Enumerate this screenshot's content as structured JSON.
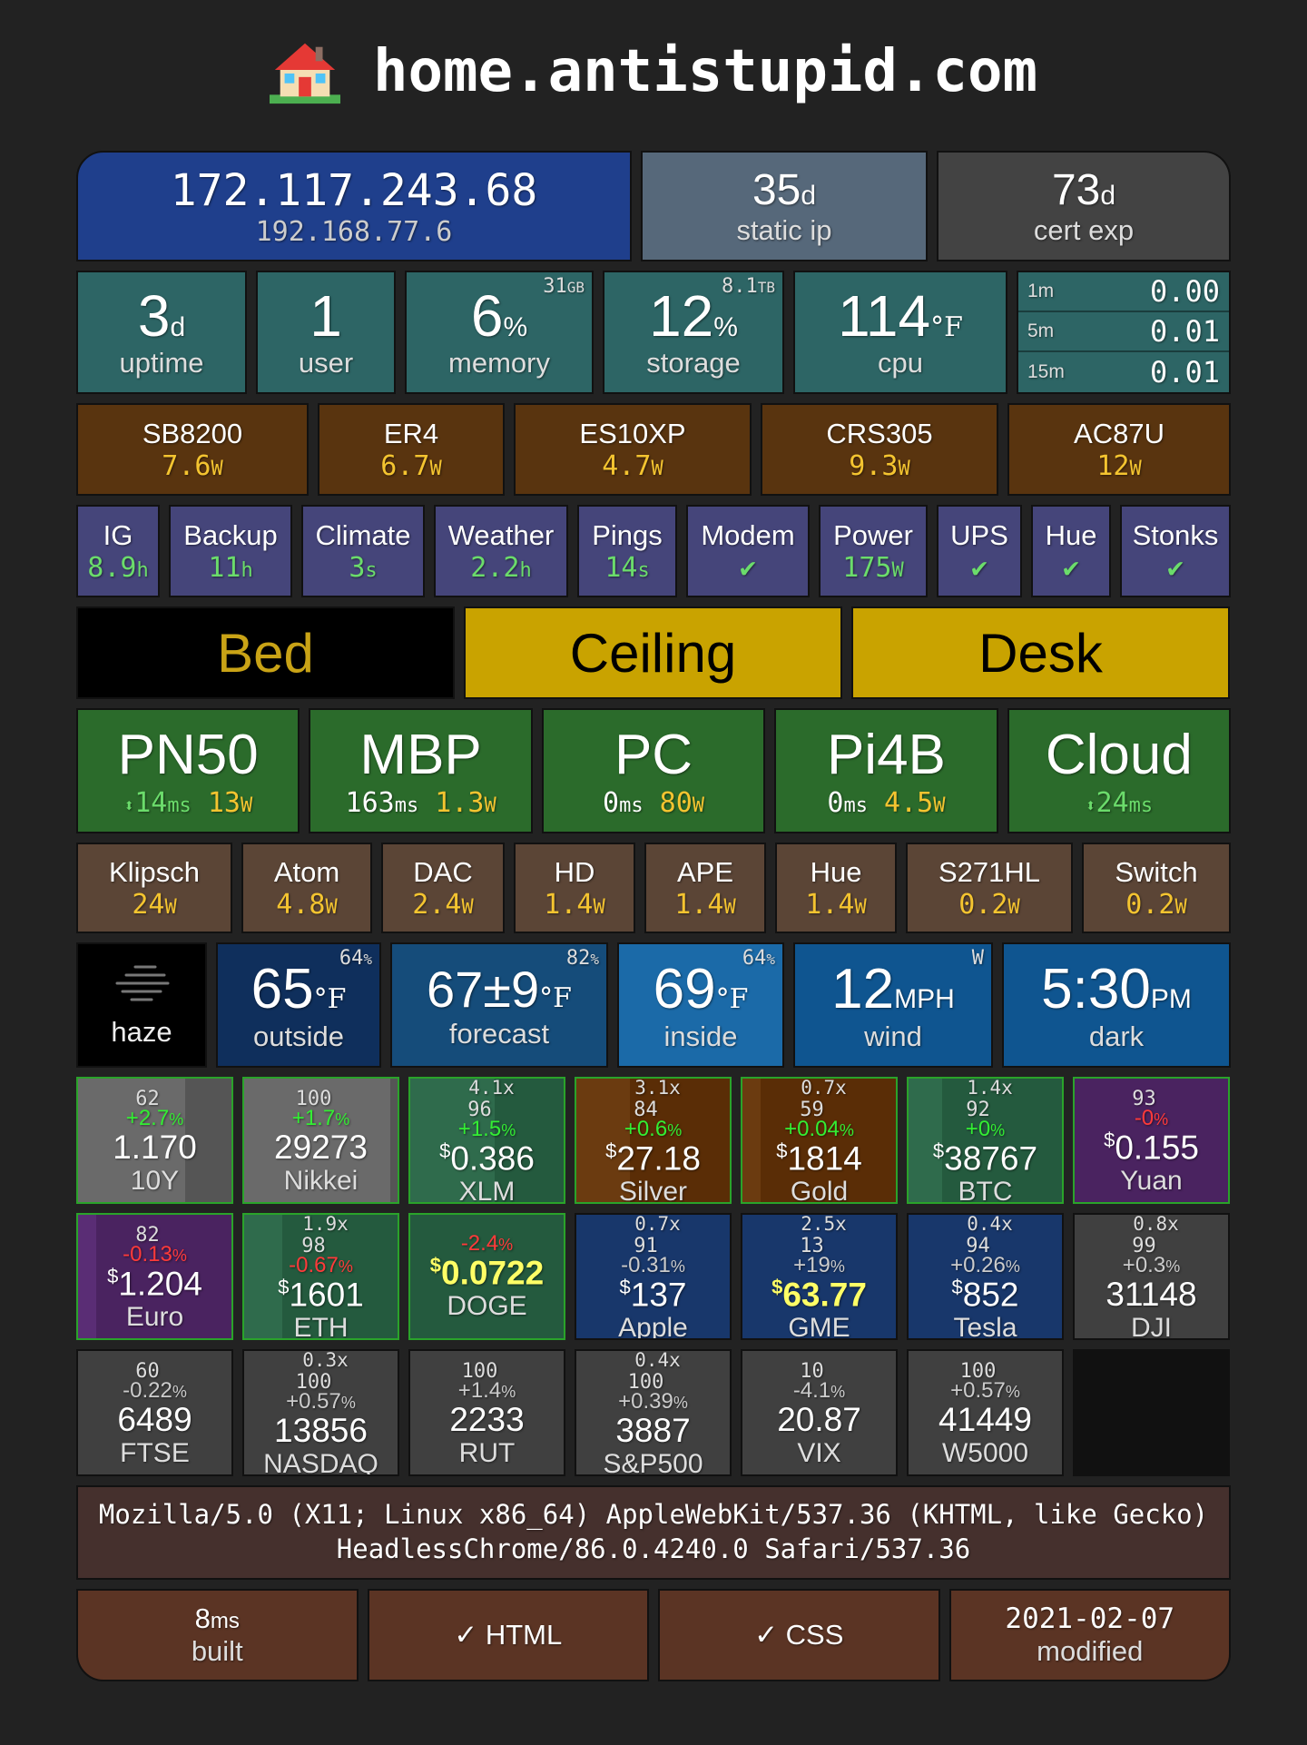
{
  "title": "home.antistupid.com",
  "network": {
    "public_ip": "172.117.243.68",
    "local_ip": "192.168.77.6",
    "static": {
      "value": "35",
      "unit": "d",
      "label": "static ip"
    },
    "cert": {
      "value": "73",
      "unit": "d",
      "label": "cert exp"
    }
  },
  "system": {
    "uptime": {
      "value": "3",
      "unit": "d",
      "label": "uptime"
    },
    "user": {
      "value": "1",
      "label": "user"
    },
    "memory": {
      "value": "6",
      "unit": "%",
      "label": "memory",
      "corner": "31",
      "corner_unit": "GB"
    },
    "storage": {
      "value": "12",
      "unit": "%",
      "label": "storage",
      "corner": "8.1",
      "corner_unit": "TB"
    },
    "cpu": {
      "value": "114",
      "unit": "°F",
      "label": "cpu"
    },
    "load": [
      {
        "k": "1m",
        "v": "0.00"
      },
      {
        "k": "5m",
        "v": "0.01"
      },
      {
        "k": "15m",
        "v": "0.01"
      }
    ]
  },
  "gear": [
    {
      "name": "SB8200",
      "val": "7.6",
      "unit": "W"
    },
    {
      "name": "ER4",
      "val": "6.7",
      "unit": "W"
    },
    {
      "name": "ES10XP",
      "val": "4.7",
      "unit": "W"
    },
    {
      "name": "CRS305",
      "val": "9.3",
      "unit": "W"
    },
    {
      "name": "AC87U",
      "val": "12",
      "unit": "W"
    }
  ],
  "jobs": [
    {
      "name": "IG",
      "val": "8.9",
      "unit": "h"
    },
    {
      "name": "Backup",
      "val": "11",
      "unit": "h"
    },
    {
      "name": "Climate",
      "val": "3",
      "unit": "s"
    },
    {
      "name": "Weather",
      "val": "2.2",
      "unit": "h"
    },
    {
      "name": "Pings",
      "val": "14",
      "unit": "s"
    },
    {
      "name": "Modem",
      "val": "✔",
      "unit": ""
    },
    {
      "name": "Power",
      "val": "175",
      "unit": "W"
    },
    {
      "name": "UPS",
      "val": "✔",
      "unit": ""
    },
    {
      "name": "Hue",
      "val": "✔",
      "unit": ""
    },
    {
      "name": "Stonks",
      "val": "✔",
      "unit": ""
    }
  ],
  "lights": [
    {
      "name": "Bed",
      "on": false
    },
    {
      "name": "Ceiling",
      "on": true
    },
    {
      "name": "Desk",
      "on": true
    }
  ],
  "computers": [
    {
      "name": "PN50",
      "arrow": "⬍",
      "ping": "14",
      "ping_unit": "ms",
      "power": "13",
      "power_unit": "W"
    },
    {
      "name": "MBP",
      "arrow": "",
      "ping": "163",
      "ping_unit": "ms",
      "power": "1.3",
      "power_unit": "W"
    },
    {
      "name": "PC",
      "arrow": "",
      "ping": "0",
      "ping_unit": "ms",
      "power": "80",
      "power_unit": "W"
    },
    {
      "name": "Pi4B",
      "arrow": "",
      "ping": "0",
      "ping_unit": "ms",
      "power": "4.5",
      "power_unit": "W"
    },
    {
      "name": "Cloud",
      "arrow": "⬍",
      "ping": "24",
      "ping_unit": "ms",
      "power": "",
      "power_unit": ""
    }
  ],
  "devices": [
    {
      "name": "Klipsch",
      "val": "24",
      "unit": "W"
    },
    {
      "name": "Atom",
      "val": "4.8",
      "unit": "W"
    },
    {
      "name": "DAC",
      "val": "2.4",
      "unit": "W"
    },
    {
      "name": "HD",
      "val": "1.4",
      "unit": "W"
    },
    {
      "name": "APE",
      "val": "1.4",
      "unit": "W"
    },
    {
      "name": "Hue",
      "val": "1.4",
      "unit": "W"
    },
    {
      "name": "S271HL",
      "val": "0.2",
      "unit": "W"
    },
    {
      "name": "Switch",
      "val": "0.2",
      "unit": "W"
    }
  ],
  "weather": {
    "condition": "haze",
    "outside": {
      "value": "65",
      "unit": "°F",
      "label": "outside",
      "corner": "64",
      "corner_unit": "%"
    },
    "forecast": {
      "value": "67±9",
      "unit": "°F",
      "label": "forecast",
      "corner": "82",
      "corner_unit": "%"
    },
    "inside": {
      "value": "69",
      "unit": "°F",
      "label": "inside",
      "corner": "64",
      "corner_unit": "%"
    },
    "wind": {
      "value": "12",
      "unit": "MPH",
      "label": "wind",
      "corner": "W"
    },
    "dark": {
      "value": "5:30",
      "unit": "PM",
      "label": "dark"
    }
  },
  "stocks_row1": [
    {
      "name": "10Y",
      "chg": "+2.7",
      "price": "1.170",
      "dollar": "",
      "score": "62",
      "mult": "",
      "chg_color": "brgrn",
      "bg": "gray-bg",
      "border": true,
      "bar": 0.7,
      "bar_color": "#6a6a6a"
    },
    {
      "name": "Nikkei",
      "chg": "+1.7",
      "price": "29273",
      "dollar": "",
      "score": "100",
      "mult": "",
      "chg_color": "brgrn",
      "bg": "gray-bg",
      "border": true,
      "bar": 0.95,
      "bar_color": "#6a6a6a"
    },
    {
      "name": "XLM",
      "chg": "+1.5",
      "price": "0.386",
      "dollar": "$",
      "score": "96",
      "mult": "4.1x",
      "chg_color": "brgrn",
      "bg": "teal-bg",
      "border": true,
      "bar": 0.55,
      "bar_color": "#2f6b4c"
    },
    {
      "name": "Silver",
      "chg": "+0.6",
      "price": "27.18",
      "dollar": "$",
      "score": "84",
      "mult": "3.1x",
      "chg_color": "brgrn",
      "bg": "brown-bg",
      "border": true,
      "bar": 0.35,
      "bar_color": "#6b3b10"
    },
    {
      "name": "Gold",
      "chg": "+0.04",
      "price": "1814",
      "dollar": "$",
      "score": "59",
      "mult": "0.7x",
      "chg_color": "brgrn",
      "bg": "brown-bg",
      "border": true,
      "bar": 0.12,
      "bar_color": "#6b3b10"
    },
    {
      "name": "BTC",
      "chg": "+0",
      "price": "38767",
      "dollar": "$",
      "score": "92",
      "mult": "1.4x",
      "chg_color": "brgrn",
      "bg": "teal-bg",
      "border": true,
      "bar": 0.22,
      "bar_color": "#2f6b4c"
    },
    {
      "name": "Yuan",
      "chg": "-0",
      "price": "0.155",
      "dollar": "$",
      "score": "93",
      "mult": "",
      "chg_color": "red",
      "bg": "purple-bg",
      "border": true,
      "bar": 0,
      "bar_color": "#5a2d75"
    }
  ],
  "stocks_row2": [
    {
      "name": "Euro",
      "chg": "-0.13",
      "price": "1.204",
      "dollar": "$",
      "score": "82",
      "mult": "",
      "chg_color": "red",
      "bg": "purple-bg",
      "border": true,
      "bar": 0.12,
      "bar_color": "#5a2d75",
      "hl": false
    },
    {
      "name": "ETH",
      "chg": "-0.67",
      "price": "1601",
      "dollar": "$",
      "score": "98",
      "mult": "1.9x",
      "chg_color": "red",
      "bg": "teal-bg",
      "border": true,
      "bar": 0.25,
      "bar_color": "#2f6b4c",
      "hl": false
    },
    {
      "name": "DOGE",
      "chg": "-2.4",
      "price": "0.0722",
      "dollar": "$",
      "score": "",
      "mult": "",
      "chg_color": "red",
      "bg": "teal-bg",
      "border": true,
      "bar": 0,
      "bar_color": "#2f6b4c",
      "hl": true
    },
    {
      "name": "Apple",
      "chg": "-0.31",
      "price": "137",
      "dollar": "$",
      "score": "91",
      "mult": "0.7x",
      "chg_color": "",
      "bg": "blue-bg",
      "border": false,
      "bar": 0,
      "bar_color": "",
      "hl": false
    },
    {
      "name": "GME",
      "chg": "+19",
      "price": "63.77",
      "dollar": "$",
      "score": "13",
      "mult": "2.5x",
      "chg_color": "",
      "bg": "blue-bg",
      "border": false,
      "bar": 0,
      "bar_color": "",
      "hl": true
    },
    {
      "name": "Tesla",
      "chg": "+0.26",
      "price": "852",
      "dollar": "$",
      "score": "94",
      "mult": "0.4x",
      "chg_color": "",
      "bg": "blue-bg",
      "border": false,
      "bar": 0,
      "bar_color": "",
      "hl": false
    },
    {
      "name": "DJI",
      "chg": "+0.3",
      "price": "31148",
      "dollar": "",
      "score": "99",
      "mult": "0.8x",
      "chg_color": "",
      "bg": "dgray-bg",
      "border": false,
      "bar": 0,
      "bar_color": "",
      "hl": false
    }
  ],
  "stocks_row3": [
    {
      "name": "FTSE",
      "chg": "-0.22",
      "price": "6489",
      "score": "60",
      "mult": ""
    },
    {
      "name": "NASDAQ",
      "chg": "+0.57",
      "price": "13856",
      "score": "100",
      "mult": "0.3x"
    },
    {
      "name": "RUT",
      "chg": "+1.4",
      "price": "2233",
      "score": "100",
      "mult": ""
    },
    {
      "name": "S&P500",
      "chg": "+0.39",
      "price": "3887",
      "score": "100",
      "mult": "0.4x"
    },
    {
      "name": "VIX",
      "chg": "-4.1",
      "price": "20.87",
      "score": "10",
      "mult": ""
    },
    {
      "name": "W5000",
      "chg": "+0.57",
      "price": "41449",
      "score": "100",
      "mult": ""
    }
  ],
  "user_agent": "Mozilla/5.0 (X11; Linux x86_64) AppleWebKit/537.36 (KHTML, like Gecko) HeadlessChrome/86.0.4240.0 Safari/537.36",
  "footer": {
    "built": {
      "value": "8",
      "unit": "ms",
      "label": "built"
    },
    "html": "✓ HTML",
    "css": "✓ CSS",
    "modified": {
      "value": "2021-02-07",
      "label": "modified"
    }
  }
}
